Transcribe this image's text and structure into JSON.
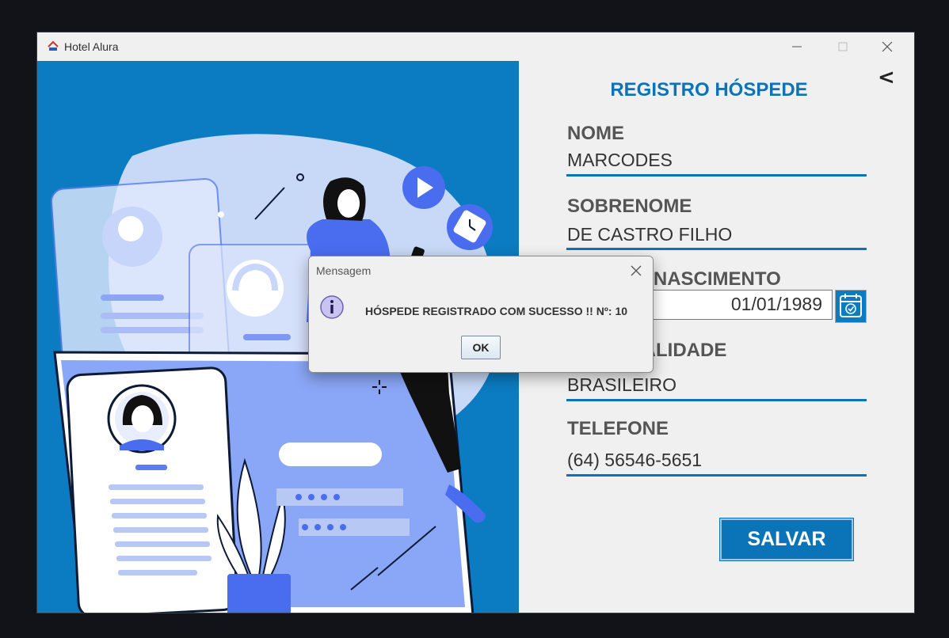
{
  "window": {
    "title": "Hotel Alura",
    "controls": [
      "minimize-icon",
      "maximize-icon",
      "close-icon"
    ]
  },
  "illustration": {
    "description_icons": [
      "profile-card-icon",
      "play-icon",
      "clock-icon",
      "plant-icon",
      "woman-phone-icon"
    ]
  },
  "form": {
    "back_label": "<",
    "title": "REGISTRO HÓSPEDE",
    "fields": [
      {
        "label": "NOME",
        "value": "MARCODES"
      },
      {
        "label": "SOBRENOME",
        "value": "DE CASTRO FILHO"
      },
      {
        "label": "DATA DE NASCIMENTO",
        "value": "01/01/1989"
      },
      {
        "label": "NACIONALIDADE",
        "value": "BRASILEIRO"
      },
      {
        "label": "TELEFONE",
        "value": "(64) 56546-5651"
      }
    ],
    "save_label": "SALVAR"
  },
  "dialog": {
    "title": "Mensagem",
    "message": "HÓSPEDE REGISTRADO COM SUCESSO !! Nº: 10",
    "ok_label": "OK"
  },
  "colors": {
    "accent": "#0b74b8",
    "panel_blue": "#0b7cc1",
    "illustration_light": "#b7c8f5",
    "illustration_mid": "#5b7cf0"
  }
}
